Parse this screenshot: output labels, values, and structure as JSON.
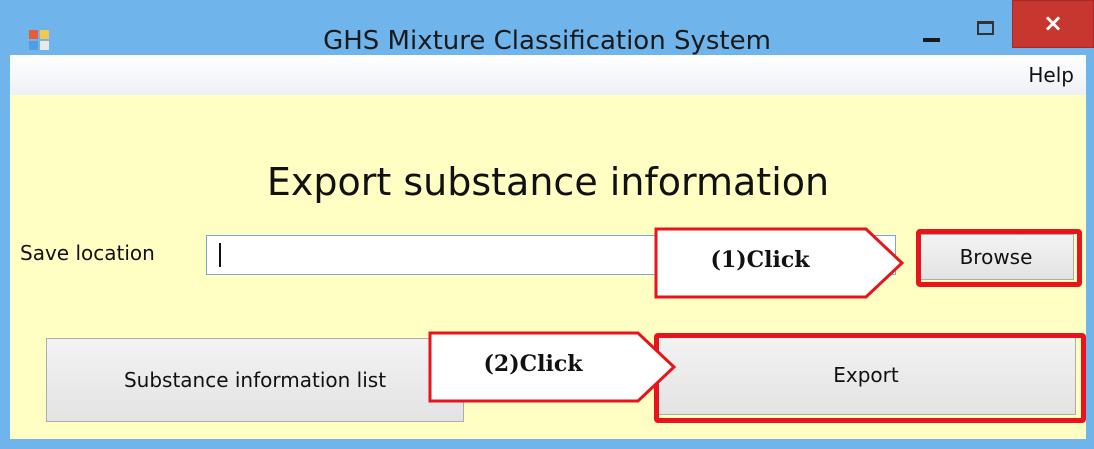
{
  "window": {
    "title": "GHS Mixture Classification System",
    "close_glyph": "×",
    "icon": "app-icon"
  },
  "menu": {
    "help_label": "Help"
  },
  "form": {
    "heading": "Export substance information",
    "save_location_label": "Save location",
    "path_value": "",
    "browse_label": "Browse",
    "export_label": "Export",
    "substance_list_label": "Substance information list"
  },
  "annotations": {
    "step1": "(1)Click",
    "step2": "(2)Click",
    "highlight_color": "#e8141b"
  },
  "colors": {
    "client_bg": "#ffffc4",
    "titlebar_bg": "#6fb4ea",
    "close_bg": "#c7372f"
  }
}
